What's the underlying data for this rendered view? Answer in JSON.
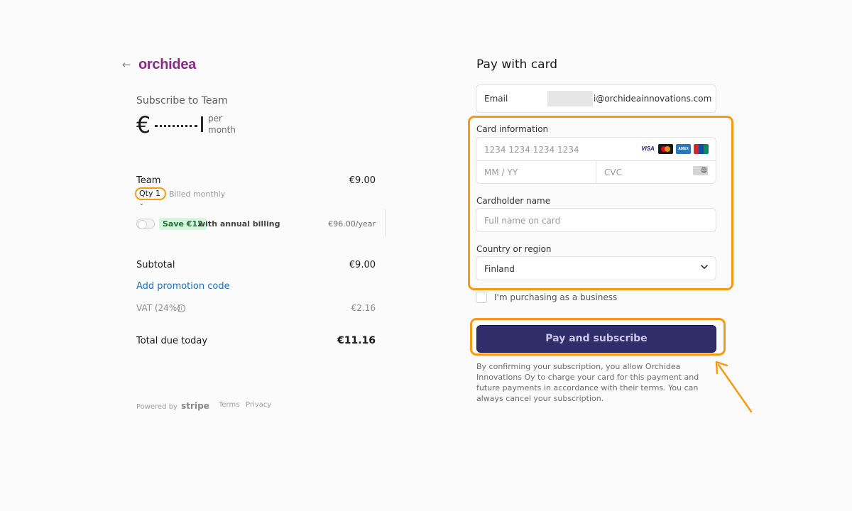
{
  "left": {
    "back_icon": "arrow-left-icon",
    "logo": "orchidea",
    "subscribe_title": "Subscribe to Team",
    "price": "€",
    "per": "per",
    "period": "month",
    "line_item": {
      "name": "Team",
      "price": "€9.00",
      "qty": "Qty 1",
      "billing": "Billed monthly"
    },
    "annual": {
      "badge": "Save €12",
      "text": "with annual billing",
      "price": "€96.00/year"
    },
    "subtotal_label": "Subtotal",
    "subtotal_value": "€9.00",
    "promo": "Add promotion code",
    "vat_label": "VAT (24%)",
    "vat_value": "€2.16",
    "total_label": "Total due today",
    "total_value": "€11.16",
    "footer": {
      "powered_by": "Powered by",
      "stripe": "stripe",
      "terms": "Terms",
      "privacy": "Privacy"
    }
  },
  "right": {
    "title": "Pay with card",
    "email_label": "Email",
    "email_value": "i@orchideainnovations.com",
    "card_label": "Card information",
    "card_number_placeholder": "1234 1234 1234 1234",
    "card_brands": [
      "VISA",
      "mastercard",
      "AMEX",
      "UnionPay"
    ],
    "expiry_placeholder": "MM / YY",
    "cvc_placeholder": "CVC",
    "cardholder_label": "Cardholder name",
    "cardholder_placeholder": "Full name on card",
    "country_label": "Country or region",
    "country_value": "Finland",
    "business_label": "I'm purchasing as a business",
    "pay_button": "Pay and subscribe",
    "disclaimer": "By confirming your subscription, you allow Orchidea Innovations Oy to charge your card for this payment and future payments in accordance with their terms. You can always cancel your subscription."
  },
  "colors": {
    "brand": "#8a2a86",
    "button": "#312c6a",
    "highlight": "#f59a14",
    "link": "#1f6fbf",
    "badge_bg": "#d6f5dd"
  }
}
